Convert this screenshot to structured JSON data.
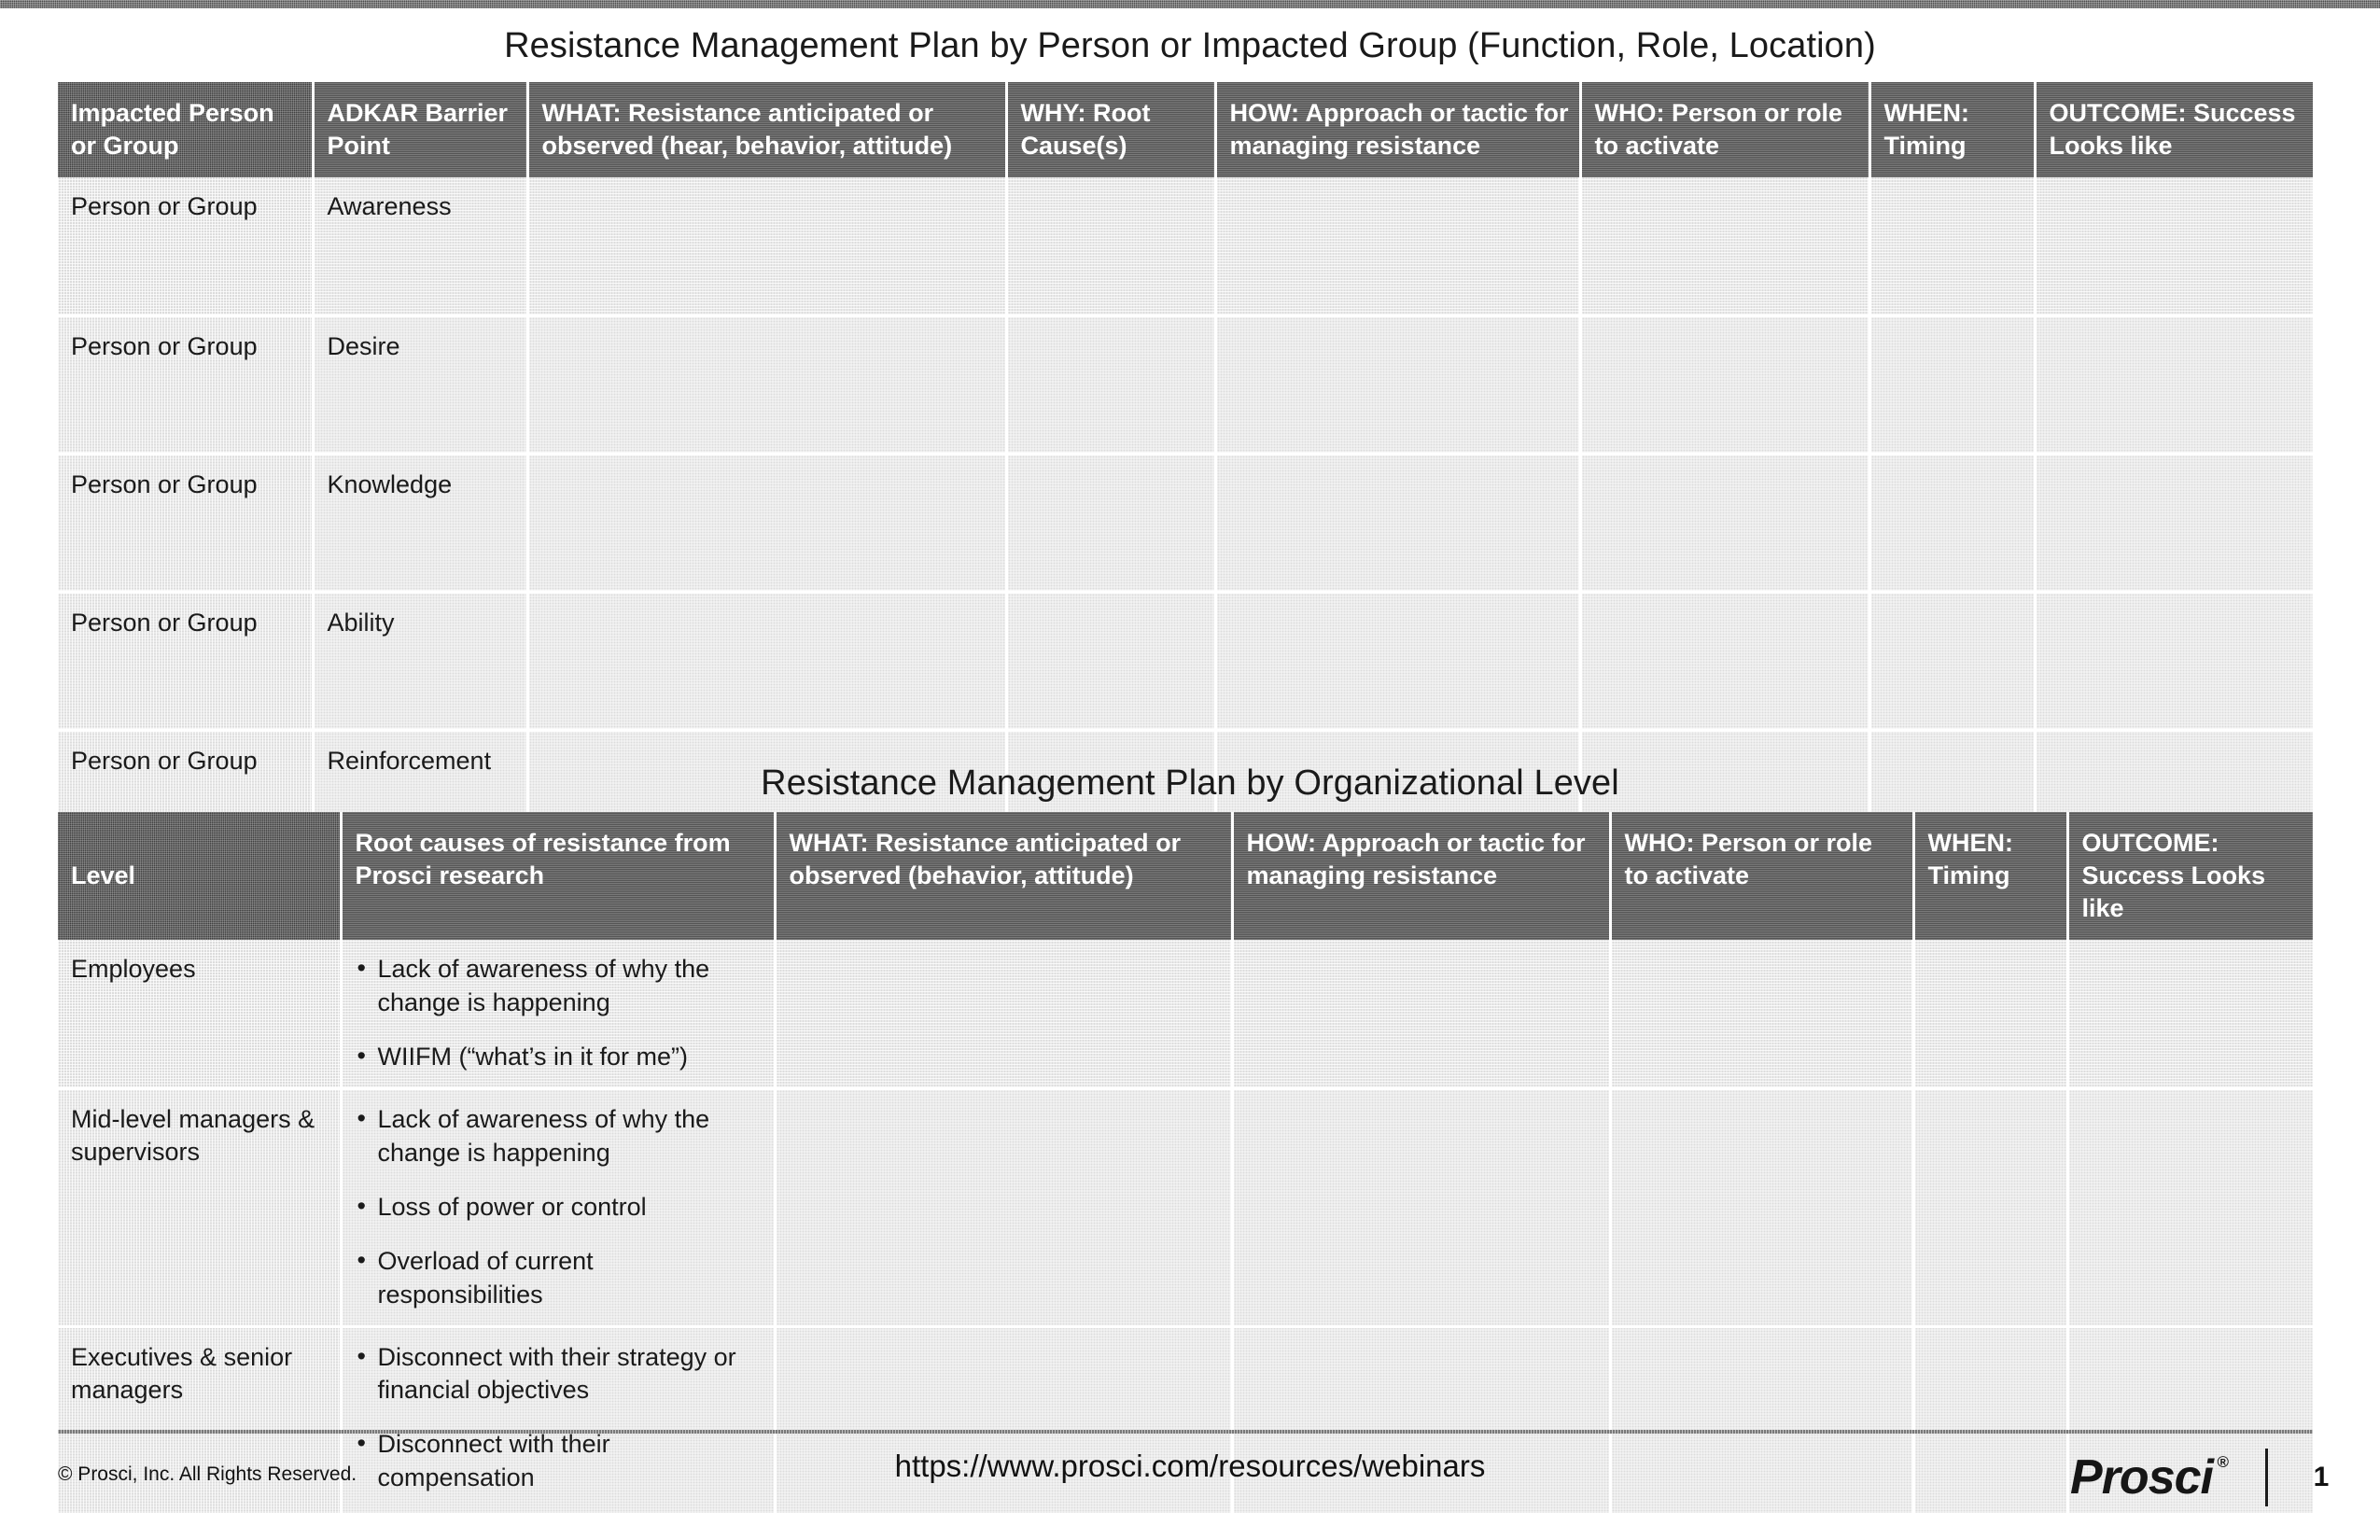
{
  "theme": {
    "header_bg": "#404040",
    "header_text": "#ffffff",
    "cell_bg": "#dcdcdc",
    "body_text": "#1a1a1a",
    "page_bg": "#ffffff"
  },
  "titles": {
    "table_1": "Resistance Management Plan by Person or Impacted Group (Function, Role, Location)",
    "table_2": "Resistance Management Plan by Organizational Level"
  },
  "table_1": {
    "headers": [
      "Impacted Person or Group",
      "ADKAR Barrier Point",
      "WHAT: Resistance anticipated or observed (hear, behavior, attitude)",
      "WHY: Root Cause(s)",
      "HOW: Approach or tactic for managing resistance",
      "WHO:  Person or role to activate",
      "WHEN: Timing",
      "OUTCOME: Success Looks like"
    ],
    "rows": [
      {
        "impacted_group": "Person or Group",
        "adkar_barrier": "Awareness",
        "what": "",
        "why": "",
        "how": "",
        "who": "",
        "when": "",
        "outcome": ""
      },
      {
        "impacted_group": "Person or Group",
        "adkar_barrier": "Desire",
        "what": "",
        "why": "",
        "how": "",
        "who": "",
        "when": "",
        "outcome": ""
      },
      {
        "impacted_group": "Person or Group",
        "adkar_barrier": "Knowledge",
        "what": "",
        "why": "",
        "how": "",
        "who": "",
        "when": "",
        "outcome": ""
      },
      {
        "impacted_group": "Person or Group",
        "adkar_barrier": "Ability",
        "what": "",
        "why": "",
        "how": "",
        "who": "",
        "when": "",
        "outcome": ""
      },
      {
        "impacted_group": "Person or Group",
        "adkar_barrier": "Reinforcement",
        "what": "",
        "why": "",
        "how": "",
        "who": "",
        "when": "",
        "outcome": ""
      }
    ]
  },
  "table_2": {
    "headers": [
      "Level",
      "Root causes of resistance from Prosci research",
      "WHAT: Resistance anticipated or observed (behavior, attitude)",
      "HOW: Approach or tactic for managing resistance",
      "WHO:  Person or role to activate",
      "WHEN: Timing",
      "OUTCOME: Success Looks like"
    ],
    "rows": [
      {
        "level": "Employees",
        "root_causes": [
          "Lack of awareness of why the change is happening",
          "WIIFM (“what’s in it for me”)"
        ],
        "what": "",
        "how": "",
        "who": "",
        "when": "",
        "outcome": ""
      },
      {
        "level": "Mid-level managers & supervisors",
        "root_causes": [
          "Lack of awareness of why the change is happening",
          "Loss of power or control",
          "Overload of current responsibilities"
        ],
        "what": "",
        "how": "",
        "who": "",
        "when": "",
        "outcome": ""
      },
      {
        "level": "Executives & senior managers",
        "root_causes": [
          "Disconnect with their strategy or financial objectives",
          "Disconnect with their compensation"
        ],
        "what": "",
        "how": "",
        "who": "",
        "when": "",
        "outcome": ""
      }
    ]
  },
  "footer": {
    "copyright": "© Prosci, Inc. All Rights Reserved.",
    "url": "https://www.prosci.com/resources/webinars",
    "brand": "Prosci",
    "brand_mark": "®",
    "page_number": "1"
  }
}
